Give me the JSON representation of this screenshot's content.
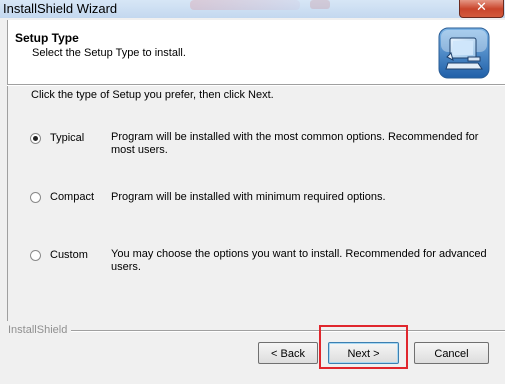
{
  "window": {
    "title": "InstallShield Wizard",
    "close_glyph": "✕"
  },
  "header": {
    "title": "Setup Type",
    "subtitle": "Select the Setup Type to install.",
    "icon": "computer-setup-icon"
  },
  "content": {
    "prompt": "Click the type of Setup you prefer, then click Next.",
    "options": [
      {
        "label": "Typical",
        "selected": true,
        "description": "Program will be installed with the most common options.  Recommended for most users."
      },
      {
        "label": "Compact",
        "selected": false,
        "description": "Program will be installed with minimum required options."
      },
      {
        "label": "Custom",
        "selected": false,
        "description": "You may choose the options you want to install. Recommended for advanced users."
      }
    ]
  },
  "footer": {
    "brand": "InstallShield",
    "back_label": "< Back",
    "next_label": "Next >",
    "cancel_label": "Cancel"
  },
  "colors": {
    "highlight": "#e0262d",
    "close_button": "#c9452c",
    "dialog_background": "#f0f0f0"
  }
}
